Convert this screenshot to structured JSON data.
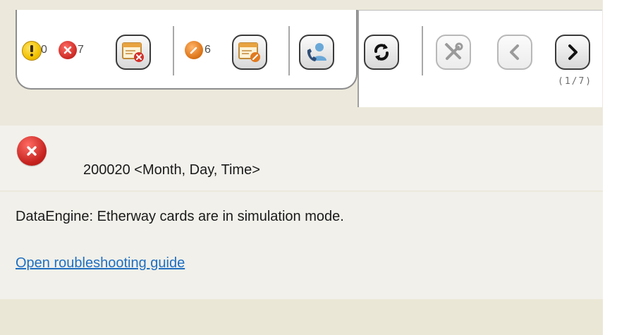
{
  "toolbar": {
    "warnings": {
      "count": "0",
      "icon": "warning-icon",
      "color": "#f2c200"
    },
    "errors": {
      "count": "7",
      "icon": "error-icon",
      "color": "#d2322c"
    },
    "edits": {
      "count": "6",
      "icon": "edit-icon",
      "color": "#e07a1f"
    },
    "buttons": [
      {
        "name": "clear-errors-button",
        "icon": "window-error-icon"
      },
      {
        "name": "clear-edits-button",
        "icon": "window-edit-icon"
      },
      {
        "name": "contact-support-button",
        "icon": "contact-support-icon"
      },
      {
        "name": "refresh-button",
        "icon": "refresh-icon"
      },
      {
        "name": "tools-button",
        "icon": "tools-icon",
        "disabled": true
      },
      {
        "name": "previous-button",
        "icon": "chevron-left-icon",
        "disabled": true
      },
      {
        "name": "next-button",
        "icon": "chevron-right-icon"
      }
    ],
    "pager": "(1/7)"
  },
  "message": {
    "icon": "error-icon",
    "code_line": "200020 <Month, Day, Time>",
    "text": "DataEngine: Etherway cards are in simulation mode.",
    "link": "Open roubleshooting guide"
  },
  "colors": {
    "band": "#ece9dc",
    "row": "#f2f1ec",
    "link": "#1f6fc2"
  }
}
